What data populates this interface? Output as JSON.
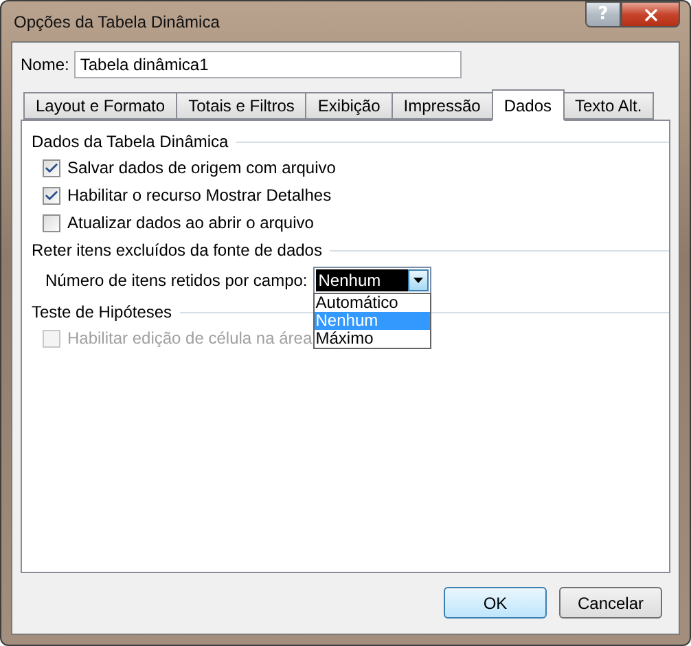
{
  "window": {
    "title": "Opções da Tabela Dinâmica",
    "help_button": "?"
  },
  "name_field": {
    "label": "Nome:",
    "value": "Tabela dinâmica1"
  },
  "tabs": [
    {
      "label": "Layout e Formato",
      "selected": false
    },
    {
      "label": "Totais e Filtros",
      "selected": false
    },
    {
      "label": "Exibição",
      "selected": false
    },
    {
      "label": "Impressão",
      "selected": false
    },
    {
      "label": "Dados",
      "selected": true
    },
    {
      "label": "Texto Alt.",
      "selected": false
    }
  ],
  "groups": [
    {
      "title": "Dados da Tabela Dinâmica",
      "items": [
        {
          "kind": "checkbox",
          "label": "Salvar dados de origem com arquivo",
          "checked": true,
          "disabled": false
        },
        {
          "kind": "checkbox",
          "label": "Habilitar o recurso Mostrar Detalhes",
          "checked": true,
          "disabled": false
        },
        {
          "kind": "checkbox",
          "label": "Atualizar dados ao abrir o arquivo",
          "checked": false,
          "disabled": false
        }
      ]
    },
    {
      "title": "Reter itens excluídos da fonte de dados",
      "items": [
        {
          "kind": "combo",
          "label": "Número de itens retidos por campo:",
          "value": "Nenhum",
          "expanded": true,
          "options": [
            {
              "label": "Automático",
              "selected": false
            },
            {
              "label": "Nenhum",
              "selected": true
            },
            {
              "label": "Máximo",
              "selected": false
            }
          ]
        }
      ]
    },
    {
      "title": "Teste de Hipóteses",
      "items": [
        {
          "kind": "checkbox",
          "label": "Habilitar edição de célula na área",
          "checked": false,
          "disabled": true
        }
      ]
    }
  ],
  "buttons": [
    {
      "label": "OK",
      "default": true
    },
    {
      "label": "Cancelar",
      "default": false
    }
  ]
}
